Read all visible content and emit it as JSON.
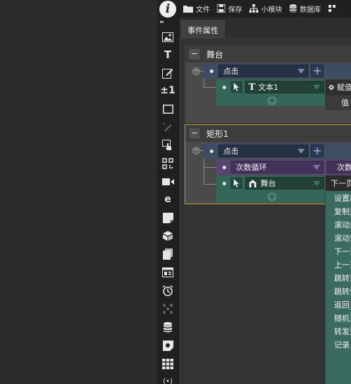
{
  "topbar": {
    "items": [
      {
        "label": "文件",
        "icon": "folder-icon"
      },
      {
        "label": "保存",
        "icon": "save-icon"
      },
      {
        "label": "小模块",
        "icon": "sitemap-icon"
      },
      {
        "label": "数据库",
        "icon": "database-icon"
      },
      {
        "label": "",
        "icon": "settings-icon"
      }
    ]
  },
  "toolbar": {
    "logo": "i",
    "expand": "▸▸",
    "tools": [
      {
        "name": "image-tool-icon",
        "glyph": ""
      },
      {
        "name": "text-tool-icon",
        "glyph": "T"
      },
      {
        "name": "edit-tool-icon",
        "glyph": ""
      },
      {
        "name": "counter-tool-icon",
        "glyph": "±1"
      },
      {
        "name": "rectangle-tool-icon",
        "glyph": ""
      },
      {
        "name": "pen-tool-icon",
        "glyph": ""
      },
      {
        "name": "touch-tool-icon",
        "glyph": ""
      },
      {
        "name": "qrcode-tool-icon",
        "glyph": ""
      },
      {
        "name": "video-tool-icon",
        "glyph": ""
      },
      {
        "name": "browser-tool-icon",
        "glyph": "e"
      },
      {
        "name": "note-tool-icon",
        "glyph": ""
      },
      {
        "name": "box-tool-icon",
        "glyph": ""
      },
      {
        "name": "pages-tool-icon",
        "glyph": ""
      },
      {
        "name": "window-tool-icon",
        "glyph": ""
      },
      {
        "name": "timer-tool-icon",
        "glyph": ""
      },
      {
        "name": "physics-tool-icon",
        "glyph": ""
      },
      {
        "name": "database-tool-icon",
        "glyph": ""
      },
      {
        "name": "camera-tool-icon",
        "glyph": ""
      },
      {
        "name": "grid-tool-icon",
        "glyph": ""
      },
      {
        "name": "signal-tool-icon",
        "glyph": "(•)"
      }
    ]
  },
  "panel": {
    "tab": "事件属性"
  },
  "groups": [
    {
      "title": "舞台",
      "event": "点击",
      "action_target": "文本1",
      "prop_label": "赋值",
      "prop_value_label": "值"
    },
    {
      "title": "矩形1",
      "event": "点击",
      "loop": "次数循环",
      "loop_prop": "次数",
      "action_target": "舞台",
      "prop_label": "下一页"
    }
  ],
  "dropdown": {
    "items": [
      "设置属性",
      "复制对象",
      "滚动到",
      "滚动到",
      "下一页",
      "上一页",
      "跳转到",
      "跳转到",
      "返回_",
      "随机页",
      "转发到",
      "记录"
    ]
  },
  "colors": {
    "selection_border": "#c69c2c",
    "event_blue": "#3e4c64",
    "action_green": "#35665a",
    "loop_purple": "#5a4471"
  }
}
